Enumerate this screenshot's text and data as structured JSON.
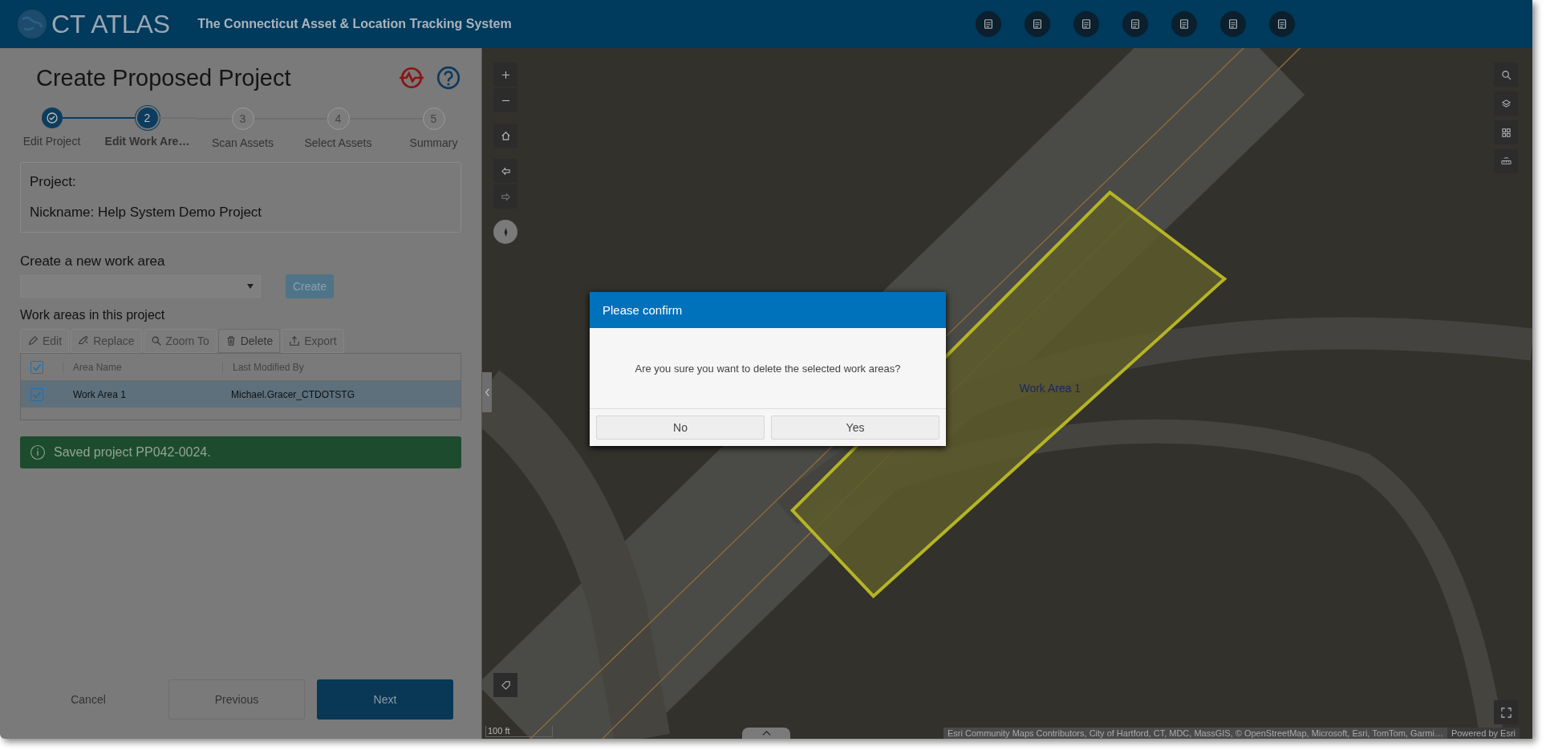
{
  "header": {
    "logo": "CT ATLAS",
    "subtitle": "The Connecticut Asset & Location Tracking System"
  },
  "panel": {
    "title": "Create Proposed Project",
    "steps": [
      {
        "label": "Edit Project",
        "completed": true,
        "selected": false
      },
      {
        "number": "2",
        "label": "Edit Work Are…",
        "completed": false,
        "selected": true
      },
      {
        "number": "3",
        "label": "Scan Assets",
        "completed": false,
        "selected": false
      },
      {
        "number": "4",
        "label": "Select Assets",
        "completed": false,
        "selected": false
      },
      {
        "number": "5",
        "label": "Summary",
        "completed": false,
        "selected": false
      }
    ],
    "project_box": [
      "Project:",
      "Nickname: Help System Demo Project"
    ],
    "new_work_area": {
      "label": "Create a new work area",
      "button": {
        "label": "Create",
        "disabled": true
      }
    },
    "work_areas": {
      "label": "Work areas in this project",
      "toolbar": [
        {
          "label": "Edit",
          "kind": "pencil",
          "selected": false
        },
        {
          "label": "Replace",
          "kind": "replace",
          "selected": false
        },
        {
          "label": "Zoom To",
          "kind": "zoom",
          "selected": false
        },
        {
          "label": "Delete",
          "kind": "trash",
          "selected": true
        },
        {
          "label": "Export",
          "kind": "export",
          "selected": false
        }
      ],
      "table": {
        "columns": [
          "Area Name",
          "Last Modified By"
        ],
        "all_checked": true,
        "rows": [
          {
            "cells": [
              "Work Area 1",
              "Michael.Gracer_CTDOTSTG"
            ],
            "checked": true,
            "selected": true
          }
        ]
      }
    },
    "message": "Saved project PP042-0024.",
    "footer": [
      {
        "label": "Cancel",
        "kind": "link"
      },
      {
        "label": "Previous",
        "kind": "outline"
      },
      {
        "label": "Next",
        "kind": "primary"
      }
    ]
  },
  "map": {
    "work_area_label": "Work Area 1",
    "scale": "100 ft",
    "attribution": "Esri Community Maps Contributors, City of Hartford, CT, MDC, MassGIS, © OpenStreetMap, Microsoft, Esri, TomTom, Garmi…",
    "powered_by": "Powered by Esri"
  },
  "dialog": {
    "title": "Please confirm",
    "message": "Are you sure you want to delete the selected work areas?",
    "buttons": [
      "No",
      "Yes"
    ]
  }
}
